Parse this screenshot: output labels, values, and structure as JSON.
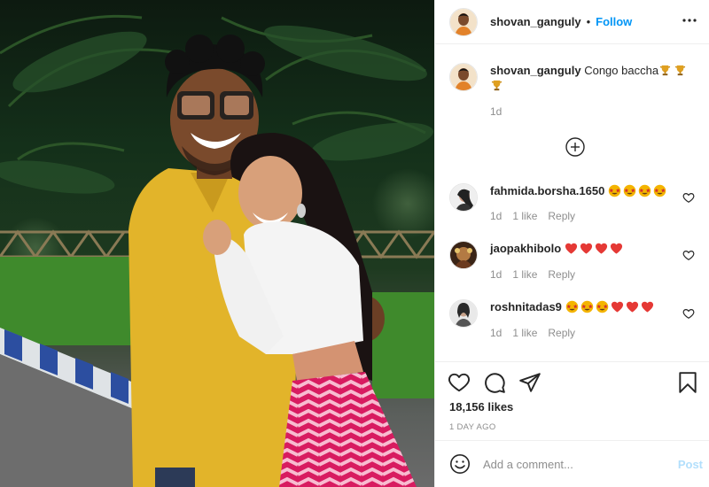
{
  "post": {
    "author": "shovan_ganguly",
    "follow_label": "Follow",
    "separator": "•"
  },
  "caption": {
    "username": "shovan_ganguly",
    "text": "Congo baccha",
    "emojis": [
      "trophy",
      "trophy",
      "trophy"
    ],
    "time": "1d"
  },
  "load_more_icon": "plus-circle-icon",
  "comments": [
    {
      "username": "fahmida.borsha.1650",
      "emojis": [
        "star-struck",
        "star-struck",
        "star-struck",
        "star-struck"
      ],
      "time": "1d",
      "likes": "1 like",
      "reply": "Reply"
    },
    {
      "username": "jaopakhibolo",
      "emojis": [
        "red-heart",
        "red-heart",
        "red-heart",
        "red-heart"
      ],
      "time": "1d",
      "likes": "1 like",
      "reply": "Reply"
    },
    {
      "username": "roshnitadas9",
      "emojis": [
        "star-struck",
        "star-struck",
        "star-struck",
        "red-heart",
        "red-heart",
        "red-heart"
      ],
      "time": "1d",
      "likes": "1 like",
      "reply": "Reply"
    }
  ],
  "actions": {
    "icons": [
      "heart-icon",
      "comment-icon",
      "share-icon",
      "bookmark-icon"
    ],
    "likes": "18,156 likes",
    "time_ago": "1 DAY AGO"
  },
  "add_comment": {
    "placeholder": "Add a comment...",
    "post_label": "Post"
  },
  "colors": {
    "accent": "#0095f6",
    "post_disabled": "#b2dffc",
    "muted": "#8e8e8e",
    "border": "#efefef"
  }
}
